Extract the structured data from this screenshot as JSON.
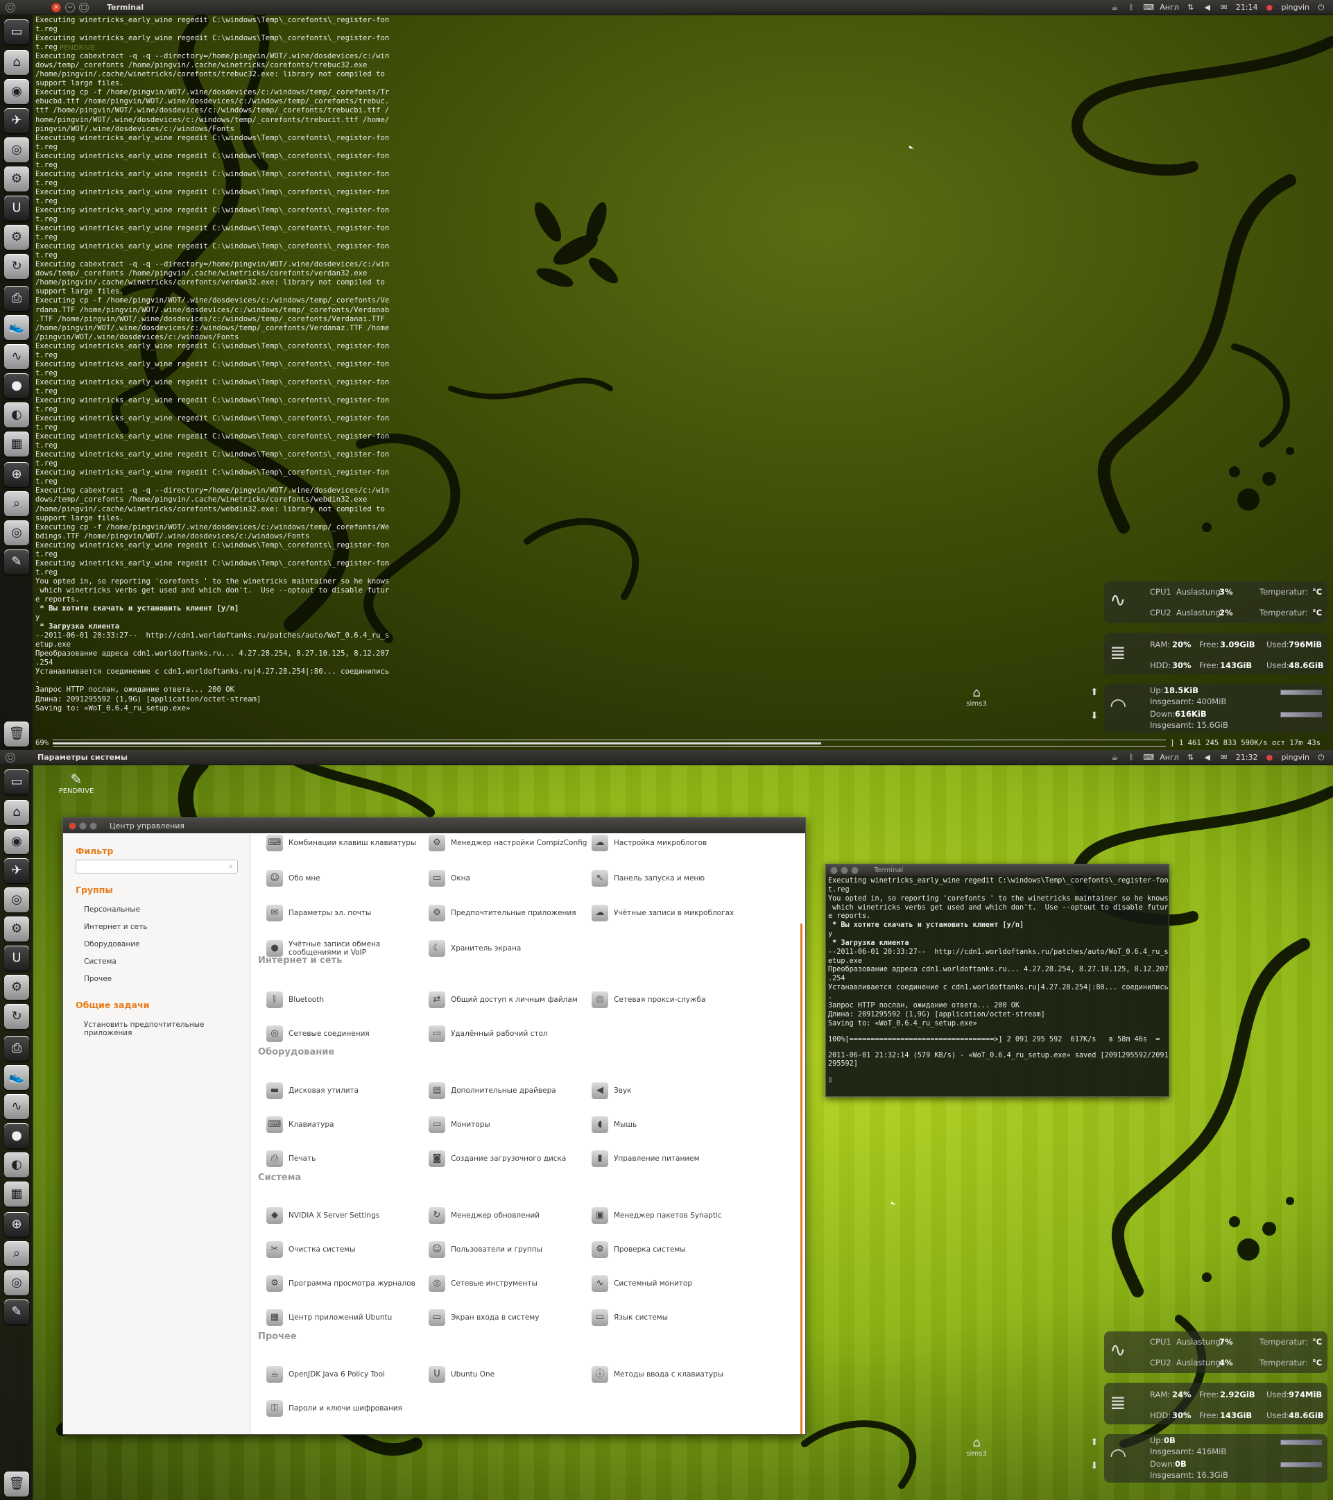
{
  "top": {
    "window_title": "Terminal",
    "lang": "Англ",
    "time": "21:14",
    "user": "pingvin",
    "terminal_lines": [
      {
        "t": "Executing winetricks_early_wine regedit C:\\windows\\Temp\\_corefonts\\_register-fon"
      },
      {
        "t": "t.reg"
      },
      {
        "t": "Executing winetricks_early_wine regedit C:\\windows\\Temp\\_corefonts\\_register-fon"
      },
      {
        "t": "t.reg"
      },
      {
        "t": "Executing cabextract -q -q --directory=/home/pingvin/WOT/.wine/dosdevices/c:/win"
      },
      {
        "t": "dows/temp/_corefonts /home/pingvin/.cache/winetricks/corefonts/trebuc32.exe"
      },
      {
        "t": "/home/pingvin/.cache/winetricks/corefonts/trebuc32.exe: library not compiled to"
      },
      {
        "t": "support large files."
      },
      {
        "t": "Executing cp -f /home/pingvin/WOT/.wine/dosdevices/c:/windows/temp/_corefonts/Tr"
      },
      {
        "t": "ebucbd.ttf /home/pingvin/WOT/.wine/dosdevices/c:/windows/temp/_corefonts/trebuc."
      },
      {
        "t": "ttf /home/pingvin/WOT/.wine/dosdevices/c:/windows/temp/_corefonts/trebucbi.ttf /"
      },
      {
        "t": "home/pingvin/WOT/.wine/dosdevices/c:/windows/temp/_corefonts/trebucit.ttf /home/"
      },
      {
        "t": "pingvin/WOT/.wine/dosdevices/c:/windows/Fonts"
      },
      {
        "t": "Executing winetricks_early_wine regedit C:\\windows\\Temp\\_corefonts\\_register-fon"
      },
      {
        "t": "t.reg"
      },
      {
        "t": "Executing winetricks_early_wine regedit C:\\windows\\Temp\\_corefonts\\_register-fon"
      },
      {
        "t": "t.reg"
      },
      {
        "t": "Executing winetricks_early_wine regedit C:\\windows\\Temp\\_corefonts\\_register-fon"
      },
      {
        "t": "t.reg"
      },
      {
        "t": "Executing winetricks_early_wine regedit C:\\windows\\Temp\\_corefonts\\_register-fon"
      },
      {
        "t": "t.reg"
      },
      {
        "t": "Executing winetricks_early_wine regedit C:\\windows\\Temp\\_corefonts\\_register-fon"
      },
      {
        "t": "t.reg"
      },
      {
        "t": "Executing winetricks_early_wine regedit C:\\windows\\Temp\\_corefonts\\_register-fon"
      },
      {
        "t": "t.reg"
      },
      {
        "t": "Executing winetricks_early_wine regedit C:\\windows\\Temp\\_corefonts\\_register-fon"
      },
      {
        "t": "t.reg"
      },
      {
        "t": "Executing cabextract -q -q --directory=/home/pingvin/WOT/.wine/dosdevices/c:/win"
      },
      {
        "t": "dows/temp/_corefonts /home/pingvin/.cache/winetricks/corefonts/verdan32.exe"
      },
      {
        "t": "/home/pingvin/.cache/winetricks/corefonts/verdan32.exe: library not compiled to"
      },
      {
        "t": "support large files."
      },
      {
        "t": "Executing cp -f /home/pingvin/WOT/.wine/dosdevices/c:/windows/temp/_corefonts/Ve"
      },
      {
        "t": "rdana.TTF /home/pingvin/WOT/.wine/dosdevices/c:/windows/temp/_corefonts/Verdanab"
      },
      {
        "t": ".TTF /home/pingvin/WOT/.wine/dosdevices/c:/windows/temp/_corefonts/Verdanai.TTF"
      },
      {
        "t": "/home/pingvin/WOT/.wine/dosdevices/c:/windows/temp/_corefonts/Verdanaz.TTF /home"
      },
      {
        "t": "/pingvin/WOT/.wine/dosdevices/c:/windows/Fonts"
      },
      {
        "t": "Executing winetricks_early_wine regedit C:\\windows\\Temp\\_corefonts\\_register-fon"
      },
      {
        "t": "t.reg"
      },
      {
        "t": "Executing winetricks_early_wine regedit C:\\windows\\Temp\\_corefonts\\_register-fon"
      },
      {
        "t": "t.reg"
      },
      {
        "t": "Executing winetricks_early_wine regedit C:\\windows\\Temp\\_corefonts\\_register-fon"
      },
      {
        "t": "t.reg"
      },
      {
        "t": "Executing winetricks_early_wine regedit C:\\windows\\Temp\\_corefonts\\_register-fon"
      },
      {
        "t": "t.reg"
      },
      {
        "t": "Executing winetricks_early_wine regedit C:\\windows\\Temp\\_corefonts\\_register-fon"
      },
      {
        "t": "t.reg"
      },
      {
        "t": "Executing winetricks_early_wine regedit C:\\windows\\Temp\\_corefonts\\_register-fon"
      },
      {
        "t": "t.reg"
      },
      {
        "t": "Executing winetricks_early_wine regedit C:\\windows\\Temp\\_corefonts\\_register-fon"
      },
      {
        "t": "t.reg"
      },
      {
        "t": "Executing winetricks_early_wine regedit C:\\windows\\Temp\\_corefonts\\_register-fon"
      },
      {
        "t": "t.reg"
      },
      {
        "t": "Executing cabextract -q -q --directory=/home/pingvin/WOT/.wine/dosdevices/c:/win"
      },
      {
        "t": "dows/temp/_corefonts /home/pingvin/.cache/winetricks/corefonts/webdin32.exe"
      },
      {
        "t": "/home/pingvin/.cache/winetricks/corefonts/webdin32.exe: library not compiled to"
      },
      {
        "t": "support large files."
      },
      {
        "t": "Executing cp -f /home/pingvin/WOT/.wine/dosdevices/c:/windows/temp/_corefonts/We"
      },
      {
        "t": "bdings.TTF /home/pingvin/WOT/.wine/dosdevices/c:/windows/Fonts"
      },
      {
        "t": "Executing winetricks_early_wine regedit C:\\windows\\Temp\\_corefonts\\_register-fon"
      },
      {
        "t": "t.reg"
      },
      {
        "t": "Executing winetricks_early_wine regedit C:\\windows\\Temp\\_corefonts\\_register-fon"
      },
      {
        "t": "t.reg"
      },
      {
        "t": "You opted in, so reporting 'corefonts ' to the winetricks maintainer so he knows"
      },
      {
        "t": " which winetricks verbs get used and which don't.  Use --optout to disable futur"
      },
      {
        "t": "e reports."
      },
      {
        "t": " * Вы хотите скачать и установить клиент [y/n]",
        "b": true
      },
      {
        "t": "y"
      },
      {
        "t": " * Загрузка клиента",
        "b": true
      },
      {
        "t": "--2011-06-01 20:33:27--  http://cdn1.worldoftanks.ru/patches/auto/WoT_0.6.4_ru_s"
      },
      {
        "t": "etup.exe"
      },
      {
        "t": "Преобразование адреса cdn1.worldoftanks.ru... 4.27.28.254, 8.27.10.125, 8.12.207"
      },
      {
        "t": ".254"
      },
      {
        "t": "Устанавливается соединение с cdn1.worldoftanks.ru|4.27.28.254|:80... соединились"
      },
      {
        "t": "."
      },
      {
        "t": "Запрос HTTP послан, ожидание ответа... 200 OK"
      },
      {
        "t": "Длина: 2091295592 (1,9G) [application/octet-stream]"
      },
      {
        "t": "Saving to: «WoT_0.6.4_ru_setup.exe»"
      }
    ],
    "progress_percent_label": "69%",
    "progress_fraction": 0.69,
    "progress_meta": "] 1 461 245 833  590K/s  ост 17m 43s",
    "desktop_icon": "sims3",
    "pendrive_overlay": "PENDRIVE",
    "conky": {
      "cpu1": "CPU1",
      "cpu1_label": "Auslastung:",
      "cpu1_val": "3%",
      "cpu1_temp": "Temperatur:",
      "cpu1_temp_val": "°C",
      "cpu2": "CPU2",
      "cpu2_label": "Auslastung:",
      "cpu2_val": "2%",
      "cpu2_temp": "Temperatur:",
      "cpu2_temp_val": "°C",
      "ram": "RAM:",
      "ram_val": "20%",
      "ram_free": "Free:",
      "ram_free_val": "3.09GiB",
      "ram_used": "Used:",
      "ram_used_val": "796MiB",
      "hdd": "HDD:",
      "hdd_val": "30%",
      "hdd_free": "Free:",
      "hdd_free_val": "143GiB",
      "hdd_used": "Used:",
      "hdd_used_val": "48.6GiB",
      "up": "Up:",
      "up_val": "18.5KiB",
      "up_total": "Insgesamt: 400MiB",
      "down": "Down:",
      "down_val": "616KiB",
      "down_total": "Insgesamt: 15.6GiB"
    }
  },
  "bottom": {
    "window_title": "Параметры системы",
    "lang": "Англ",
    "time": "21:32",
    "user": "pingvin",
    "pendrive": "PENDRIVE",
    "desktop_icon": "sims3",
    "cc": {
      "title": "Центр управления",
      "filter_heading": "Фильтр",
      "groups_heading": "Группы",
      "groups": [
        "Персональные",
        "Интернет и сеть",
        "Оборудование",
        "Система",
        "Прочее"
      ],
      "tasks_heading": "Общие задачи",
      "tasks": [
        "Установить предпочтительные приложения"
      ],
      "sections": {
        "internet": "Интернет и сеть",
        "hardware": "Оборудование",
        "system": "Система",
        "other": "Прочее"
      },
      "apps": {
        "a0": "Комбинации клавиш клавиатуры",
        "a1": "Менеджер настройки CompizConfig",
        "a2": "Настройка микроблогов",
        "a3": "Обо мне",
        "a4": "Окна",
        "a5": "Панель запуска и меню",
        "a6": "Параметры эл. почты",
        "a7": "Предпочтительные приложения",
        "a8": "Учётные записи в микроблогах",
        "a9": "Учётные записи обмена сообщениями и VoIP",
        "a10": "Хранитель экрана",
        "b0": "Bluetooth",
        "b1": "Общий доступ к личным файлам",
        "b2": "Сетевая прокси-служба",
        "b3": "Сетевые соединения",
        "b4": "Удалённый рабочий стол",
        "c0": "Дисковая утилита",
        "c1": "Дополнительные драйвера",
        "c2": "Звук",
        "c3": "Клавиатура",
        "c4": "Мониторы",
        "c5": "Мышь",
        "c6": "Печать",
        "c7": "Создание загрузочного диска",
        "c8": "Управление питанием",
        "d0": "NVIDIA X Server Settings",
        "d1": "Менеджер обновлений",
        "d2": "Менеджер пакетов Synaptic",
        "d3": "Очистка системы",
        "d4": "Пользователи и группы",
        "d5": "Проверка системы",
        "d6": "Программа просмотра журналов",
        "d7": "Сетевые инструменты",
        "d8": "Системный монитор",
        "d9": "Центр приложений Ubuntu",
        "d10": "Экран входа в систему",
        "d11": "Язык системы",
        "e0": "OpenJDK Java 6 Policy Tool",
        "e1": "Ubuntu One",
        "e2": "Методы ввода с клавиатуры",
        "e3": "Пароли и ключи шифрования"
      }
    },
    "terminal": {
      "title": "Terminal",
      "lines": [
        {
          "t": "Executing winetricks_early_wine regedit C:\\windows\\Temp\\_corefonts\\_register-fon"
        },
        {
          "t": "t.reg"
        },
        {
          "t": "You opted in, so reporting 'corefonts ' to the winetricks maintainer so he knows"
        },
        {
          "t": " which winetricks verbs get used and which don't.  Use --optout to disable futur"
        },
        {
          "t": "e reports."
        },
        {
          "t": " * Вы хотите скачать и установить клиент [y/n]",
          "b": true
        },
        {
          "t": "y"
        },
        {
          "t": " * Загрузка клиента",
          "b": true
        },
        {
          "t": "--2011-06-01 20:33:27--  http://cdn1.worldoftanks.ru/patches/auto/WoT_0.6.4_ru_s"
        },
        {
          "t": "etup.exe"
        },
        {
          "t": "Преобразование адреса cdn1.worldoftanks.ru... 4.27.28.254, 8.27.10.125, 8.12.207"
        },
        {
          "t": ".254"
        },
        {
          "t": "Устанавливается соединение с cdn1.worldoftanks.ru|4.27.28.254|:80... соединились"
        },
        {
          "t": "."
        },
        {
          "t": "Запрос HTTP послан, ожидание ответа... 200 OK"
        },
        {
          "t": "Длина: 2091295592 (1,9G) [application/octet-stream]"
        },
        {
          "t": "Saving to: «WoT_0.6.4_ru_setup.exe»"
        },
        {
          "t": ""
        },
        {
          "t": "100%[==================================>] 2 091 295 592  617K/s   в 58m 46s  ="
        },
        {
          "t": ""
        },
        {
          "t": "2011-06-01 21:32:14 (579 KB/s) - «WoT_0.6.4_ru_setup.exe» saved [2091295592/2091"
        },
        {
          "t": "295592]"
        },
        {
          "t": ""
        },
        {
          "t": "▯"
        }
      ]
    },
    "conky": {
      "cpu1": "CPU1",
      "cpu1_label": "Auslastung:",
      "cpu1_val": "7%",
      "cpu1_temp": "Temperatur:",
      "cpu1_temp_val": "°C",
      "cpu2": "CPU2",
      "cpu2_label": "Auslastung:",
      "cpu2_val": "4%",
      "cpu2_temp": "Temperatur:",
      "cpu2_temp_val": "°C",
      "ram": "RAM:",
      "ram_val": "24%",
      "ram_free": "Free:",
      "ram_free_val": "2.92GiB",
      "ram_used": "Used:",
      "ram_used_val": "974MiB",
      "hdd": "HDD:",
      "hdd_val": "30%",
      "hdd_free": "Free:",
      "hdd_free_val": "143GiB",
      "hdd_used": "Used:",
      "hdd_used_val": "48.6GiB",
      "up": "Up:",
      "up_val": "0B",
      "up_total": "Insgesamt: 416MiB",
      "down": "Down:",
      "down_val": "0B",
      "down_total": "Insgesamt: 16.3GiB"
    }
  },
  "icons": {
    "launcher": [
      "terminal-icon",
      "home-icon",
      "chrome-icon",
      "thunderbird-icon",
      "ubuntu-icon",
      "settings-icon",
      "ubuntu-one-icon",
      "gear-icon",
      "update-icon",
      "printer-icon",
      "shoes-icon",
      "monitor-icon",
      "chat-icon",
      "eye-icon",
      "workspace-icon",
      "zoom-icon",
      "search-icon",
      "disc-icon",
      "usb-icon",
      "trash-icon"
    ]
  }
}
